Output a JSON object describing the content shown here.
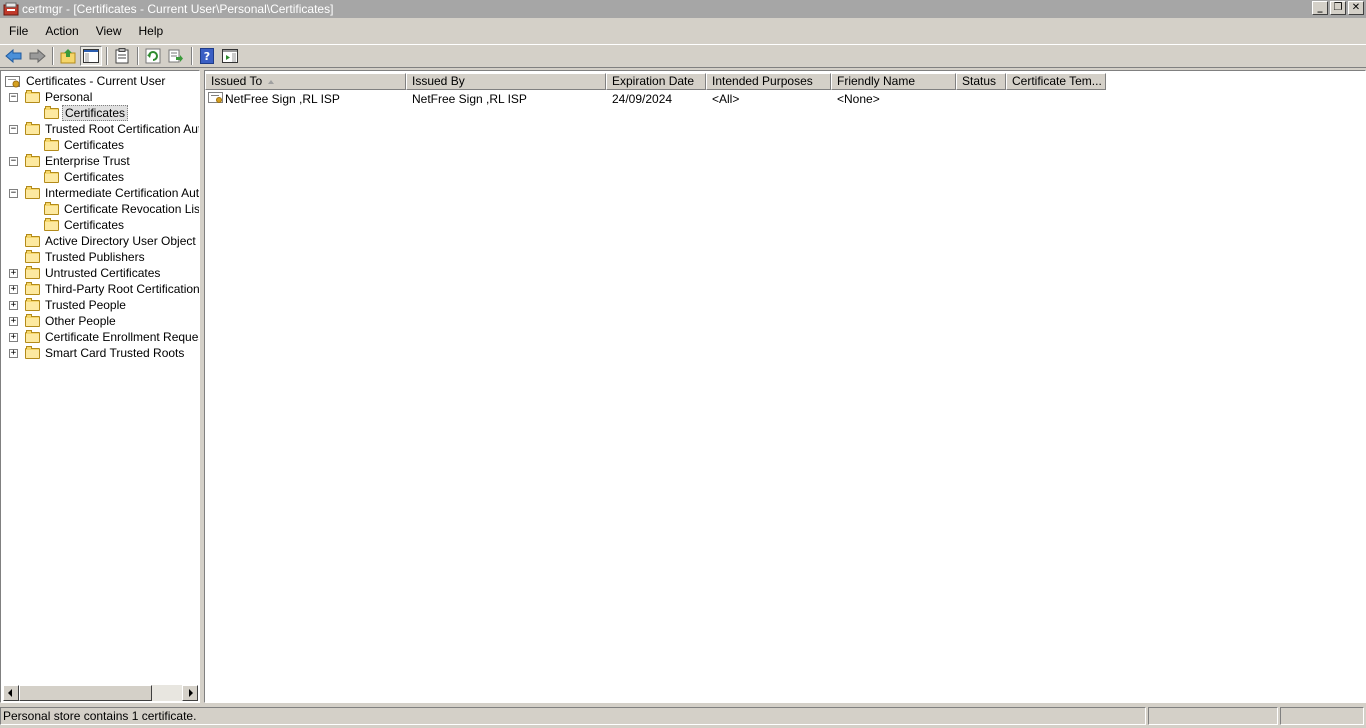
{
  "window": {
    "title": "certmgr - [Certificates - Current User\\Personal\\Certificates]",
    "min_glyph": "_",
    "restore_glyph": "❐",
    "close_glyph": "✕"
  },
  "menu": [
    "File",
    "Action",
    "View",
    "Help"
  ],
  "toolbar": {
    "buttons": [
      "back-icon",
      "forward-icon",
      "up-folder-icon",
      "show-hide-console-tree-icon",
      "properties-icon",
      "refresh-icon",
      "export-list-icon",
      "help-icon",
      "show-hide-action-pane-icon"
    ]
  },
  "tree": {
    "root": "Certificates - Current User",
    "nodes": [
      {
        "label": "Personal",
        "expander": "−",
        "children": [
          {
            "label": "Certificates",
            "selected": true
          }
        ]
      },
      {
        "label": "Trusted Root Certification Autho",
        "expander": "−",
        "children": [
          {
            "label": "Certificates"
          }
        ]
      },
      {
        "label": "Enterprise Trust",
        "expander": "−",
        "children": [
          {
            "label": "Certificates"
          }
        ]
      },
      {
        "label": "Intermediate Certification Autho",
        "expander": "−",
        "children": [
          {
            "label": "Certificate Revocation List"
          },
          {
            "label": "Certificates"
          }
        ]
      },
      {
        "label": "Active Directory User Object",
        "expander": ""
      },
      {
        "label": "Trusted Publishers",
        "expander": ""
      },
      {
        "label": "Untrusted Certificates",
        "expander": "+"
      },
      {
        "label": "Third-Party Root Certification Au",
        "expander": "+"
      },
      {
        "label": "Trusted People",
        "expander": "+"
      },
      {
        "label": "Other People",
        "expander": "+"
      },
      {
        "label": "Certificate Enrollment Requests",
        "expander": "+"
      },
      {
        "label": "Smart Card Trusted Roots",
        "expander": "+"
      }
    ]
  },
  "list": {
    "columns": [
      "Issued To",
      "Issued By",
      "Expiration Date",
      "Intended Purposes",
      "Friendly Name",
      "Status",
      "Certificate Tem..."
    ],
    "rows": [
      {
        "issued_to": "NetFree Sign ,RL ISP",
        "issued_by": "NetFree Sign ,RL ISP",
        "expiration": "24/09/2024",
        "purposes": "<All>",
        "friendly_name": "<None>",
        "status": "",
        "template": ""
      }
    ]
  },
  "status": {
    "text": "Personal store contains 1 certificate."
  }
}
